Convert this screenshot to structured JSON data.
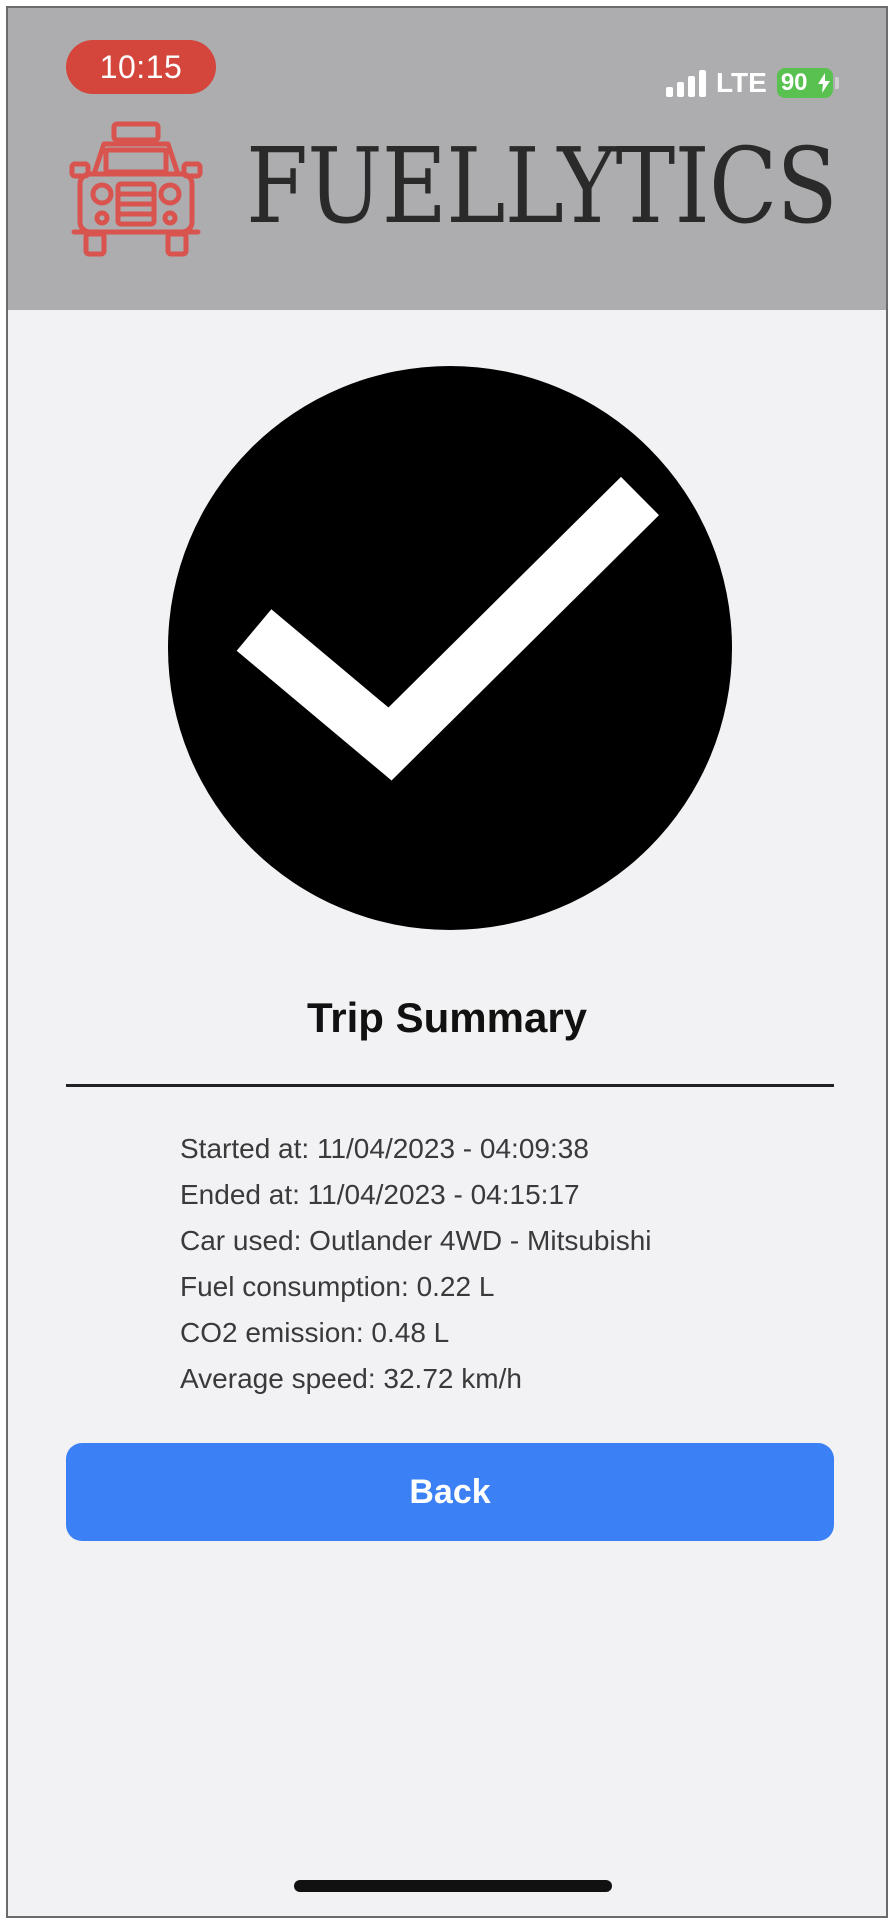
{
  "status_bar": {
    "time": "10:15",
    "network": "LTE",
    "battery": "90",
    "icons": [
      "signal-bars-icon",
      "battery-charging-icon"
    ]
  },
  "header": {
    "brand": "FUELLYTICS",
    "logo_icon": "taxi-front-icon",
    "background_color": "#adadaf",
    "logo_color": "#d9534f"
  },
  "main": {
    "status_icon": "check-circle-icon",
    "title": "Trip Summary",
    "details": [
      "Started at: 11/04/2023 - 04:09:38",
      "Ended at: 11/04/2023 - 04:15:17",
      "Car used: Outlander 4WD - Mitsubishi",
      "Fuel consumption: 0.22 L",
      "CO2 emission: 0.48 L",
      "Average speed: 32.72 km/h"
    ],
    "back_label": "Back",
    "accent_color": "#3b80f5"
  }
}
